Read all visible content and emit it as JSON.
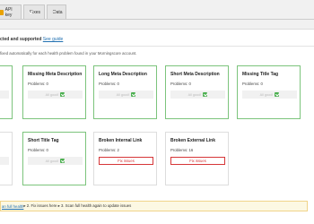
{
  "tabs": [
    {
      "label": "API key",
      "icon": "key-icon"
    },
    {
      "label": "Fixes",
      "icon": "check-icon"
    },
    {
      "label": "Data",
      "icon": "disk-icon"
    }
  ],
  "connection": {
    "status_text": "cted and supported",
    "link_text": "See guide"
  },
  "intro_text": "fixed automatically for each health problem found in your Morningscore account.",
  "cards": [
    {
      "title": "Missing Meta Description",
      "problems": "Problems: 0",
      "status": "All good!",
      "fixed": true
    },
    {
      "title": "Long Meta Description",
      "problems": "Problems: 0",
      "status": "All good!",
      "fixed": true
    },
    {
      "title": "Short Meta Description",
      "problems": "Problems: 0",
      "status": "All good!",
      "fixed": true
    },
    {
      "title": "Missing Title Tag",
      "problems": "Problems: 0",
      "status": "All good!",
      "fixed": true
    },
    {
      "title": "Short Title Tag",
      "problems": "Problems: 0",
      "status": "All good!",
      "fixed": true
    },
    {
      "title": "Broken Internal Link",
      "problems": "Problems: 2",
      "button": "Fix issues",
      "fixed": false
    },
    {
      "title": "Broken External Link",
      "problems": "Problems: 16",
      "button": "Fix issues",
      "fixed": false
    }
  ],
  "notice": {
    "link_text": "an full health",
    "text": " ▸ 2. Fix issues here ▸ 3. Scan full health again to update issues"
  },
  "colors": {
    "ok_border": "#7cc47c",
    "error": "#d63638",
    "link": "#2271b1",
    "notice_bg": "#fcf8e3"
  }
}
